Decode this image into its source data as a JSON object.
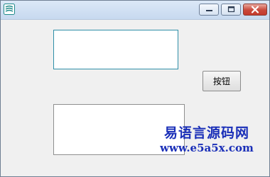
{
  "window": {
    "icon": "app-logo-icon",
    "controls": [
      "minimize-icon",
      "maximize-icon",
      "close-icon"
    ]
  },
  "form": {
    "textbox1_value": "",
    "textbox2_value": "",
    "button_label": "按钮"
  },
  "watermark": {
    "site_name": "易语言源码网",
    "site_url": "www.e5a5x.com"
  },
  "colors": {
    "watermark": "#1a2fb8",
    "close_button": "#c9483b",
    "focused_border": "#2f8fa8"
  }
}
